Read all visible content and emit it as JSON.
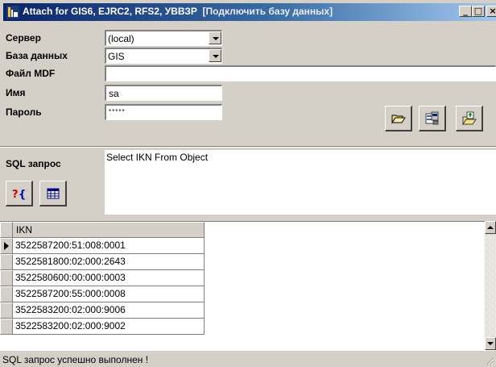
{
  "window": {
    "title": "Attach for GIS6, EJRC2, RFS2, УВВЗР",
    "title_extra": "[Подключить базу данных]",
    "minimize_glyph": "_",
    "maximize_glyph": "□",
    "close_glyph": "×"
  },
  "form": {
    "server_label": "Сервер",
    "server_value": "(local)",
    "database_label": "База данных",
    "database_value": "GIS",
    "mdf_label": "Файл MDF",
    "mdf_value": "",
    "name_label": "Имя",
    "name_value": "sa",
    "password_label": "Пароль",
    "password_value": "*****",
    "sql_label": "SQL запрос",
    "sql_value": "Select IKN From Object"
  },
  "icons": {
    "open": "folder-open-icon",
    "connect": "database-connect-icon",
    "attach": "attach-database-icon",
    "run_query": "query-help-icon",
    "table": "table-icon"
  },
  "grid": {
    "column": "IKN",
    "rows": [
      "3522587200:51:008:0001",
      "3522581800:02:000:2643",
      "3522580600:00:000:0003",
      "3522587200:55:000:0008",
      "3522583200:02:000:9006",
      "3522583200:02:000:9002"
    ]
  },
  "status": "SQL запрос успешно выполнен !",
  "colors": {
    "titlebar_start": "#0a246a",
    "titlebar_end": "#a6caf0",
    "face": "#d4d0c8"
  }
}
